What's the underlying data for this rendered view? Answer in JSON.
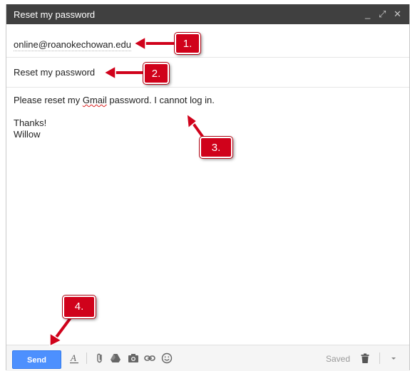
{
  "window": {
    "title": "Reset my password",
    "minimize_glyph": "_",
    "popout_glyph": "⤢",
    "close_glyph": "✕"
  },
  "compose": {
    "to": "online@roanokechowan.edu",
    "subject": "Reset my password",
    "body": {
      "line1_pre": "Please reset my ",
      "line1_misspelled": "Gmail",
      "line1_post": " password. I cannot log in.",
      "line2": "",
      "line3": "Thanks!",
      "line4": "Willow"
    }
  },
  "toolbar": {
    "send_label": "Send",
    "status": "Saved",
    "icons": [
      "formatting-icon",
      "attach-icon",
      "drive-icon",
      "photo-icon",
      "link-icon",
      "emoji-icon",
      "trash-icon",
      "more-options-icon"
    ]
  },
  "callouts": [
    {
      "label": "1."
    },
    {
      "label": "2."
    },
    {
      "label": "3."
    },
    {
      "label": "4."
    }
  ],
  "colors": {
    "titlebar": "#404040",
    "send_button": "#4d90fe",
    "callout": "#d0021b"
  }
}
